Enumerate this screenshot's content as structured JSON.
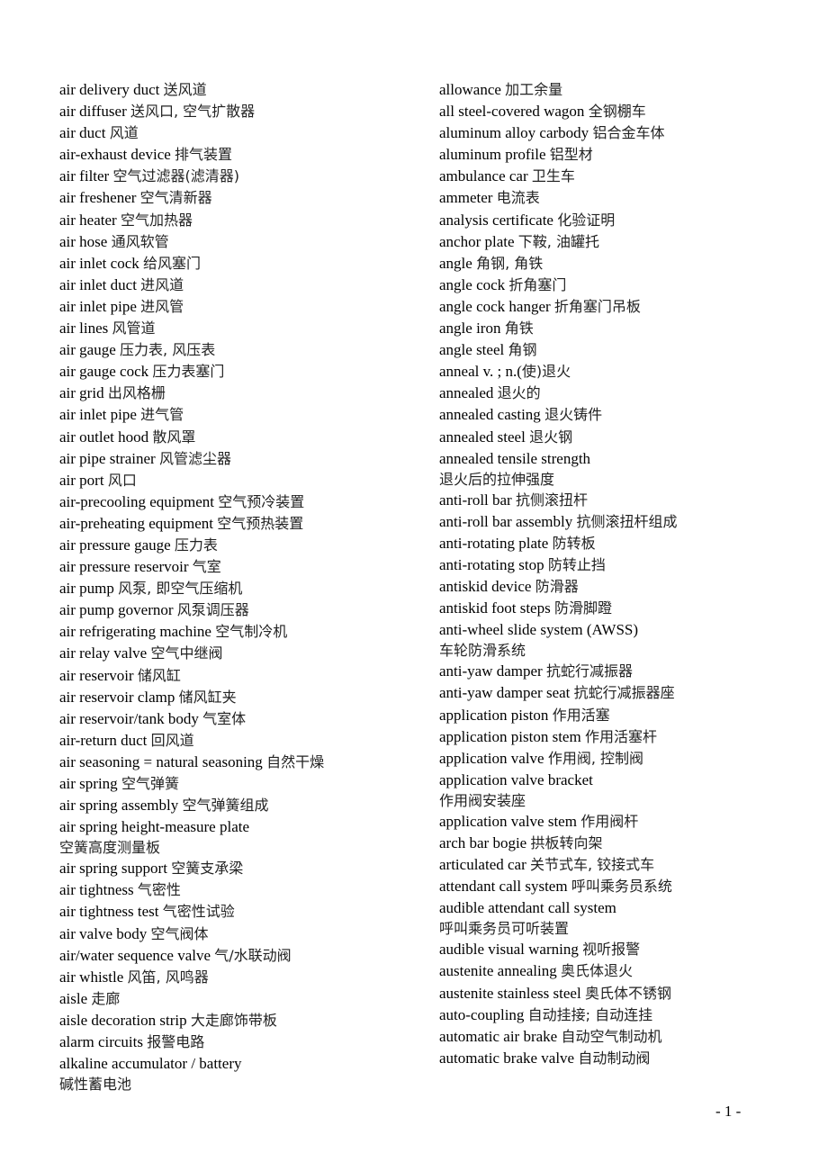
{
  "left_column": [
    {
      "en": "air delivery duct ",
      "cn": "送风道"
    },
    {
      "en": "air diffuser ",
      "cn": "送风口, 空气扩散器"
    },
    {
      "en": "air duct ",
      "cn": "风道"
    },
    {
      "en": "air-exhaust device ",
      "cn": "排气装置"
    },
    {
      "en": "air filter ",
      "cn": "空气过滤器(滤清器)"
    },
    {
      "en": "air freshener ",
      "cn": "空气清新器"
    },
    {
      "en": "air heater ",
      "cn": "空气加热器"
    },
    {
      "en": "air hose ",
      "cn": "通风软管"
    },
    {
      "en": "air inlet cock ",
      "cn": "给风塞门"
    },
    {
      "en": "air inlet duct ",
      "cn": "进风道"
    },
    {
      "en": "air inlet pipe ",
      "cn": "进风管"
    },
    {
      "en": "air lines ",
      "cn": "风管道"
    },
    {
      "en": "air gauge ",
      "cn": "压力表, 风压表"
    },
    {
      "en": "air gauge cock ",
      "cn": "压力表塞门"
    },
    {
      "en": "air grid ",
      "cn": "出风格栅"
    },
    {
      "en": "air inlet pipe ",
      "cn": "进气管"
    },
    {
      "en": "air outlet hood ",
      "cn": "散风罩"
    },
    {
      "en": "air pipe strainer ",
      "cn": "风管滤尘器"
    },
    {
      "en": "air port ",
      "cn": "风口"
    },
    {
      "en": "air-precooling equipment ",
      "cn": "空气预冷装置"
    },
    {
      "en": "air-preheating equipment ",
      "cn": "空气预热装置"
    },
    {
      "en": "air pressure gauge ",
      "cn": "压力表"
    },
    {
      "en": "air pressure reservoir ",
      "cn": "气室"
    },
    {
      "en": "air pump  ",
      "cn": "风泵, 即空气压缩机"
    },
    {
      "en": "air pump governor ",
      "cn": "风泵调压器"
    },
    {
      "en": "air refrigerating machine ",
      "cn": "空气制冷机"
    },
    {
      "en": "air relay valve ",
      "cn": "空气中继阀"
    },
    {
      "en": "air reservoir ",
      "cn": "储风缸"
    },
    {
      "en": "air reservoir clamp ",
      "cn": "储风缸夹"
    },
    {
      "en": "air reservoir/tank body ",
      "cn": "气室体"
    },
    {
      "en": "air-return duct ",
      "cn": "回风道"
    },
    {
      "en": "air seasoning = natural seasoning ",
      "cn": "自然干燥"
    },
    {
      "en": "air spring ",
      "cn": "空气弹簧"
    },
    {
      "en": "air spring assembly ",
      "cn": "空气弹簧组成"
    },
    {
      "en": "air spring height-measure plate",
      "cn": "空簧高度测量板",
      "wrap": true
    },
    {
      "en": "air spring support ",
      "cn": "空簧支承梁"
    },
    {
      "en": "air tightness ",
      "cn": "气密性"
    },
    {
      "en": "air tightness test ",
      "cn": "气密性试验"
    },
    {
      "en": "air valve body ",
      "cn": "空气阀体"
    },
    {
      "en": "air/water sequence valve ",
      "cn": "气/水联动阀"
    },
    {
      "en": "air whistle ",
      "cn": "风笛, 风鸣器"
    },
    {
      "en": "aisle  ",
      "cn": "走廊"
    },
    {
      "en": "aisle decoration strip  ",
      "cn": "大走廊饰带板"
    },
    {
      "en": "alarm circuits  ",
      "cn": "报警电路"
    },
    {
      "en": "alkaline accumulator / battery",
      "cn": "碱性蓄电池",
      "wrap": true
    }
  ],
  "right_column": [
    {
      "en": "allowance ",
      "cn": "加工余量"
    },
    {
      "en": "all steel-covered wagon ",
      "cn": "全钢棚车"
    },
    {
      "en": "aluminum alloy carbody ",
      "cn": "铝合金车体"
    },
    {
      "en": "aluminum profile ",
      "cn": "铝型材"
    },
    {
      "en": "ambulance car ",
      "cn": "卫生车"
    },
    {
      "en": "ammeter ",
      "cn": "电流表"
    },
    {
      "en": "analysis certificate ",
      "cn": "化验证明"
    },
    {
      "en": "anchor plate ",
      "cn": "下鞍, 油罐托"
    },
    {
      "en": "angle ",
      "cn": "角钢, 角铁"
    },
    {
      "en": "angle cock ",
      "cn": "折角塞门"
    },
    {
      "en": "angle cock hanger ",
      "cn": "折角塞门吊板"
    },
    {
      "en": "angle iron ",
      "cn": "角铁"
    },
    {
      "en": "angle steel ",
      "cn": "角钢"
    },
    {
      "en": "anneal v. ; n.(",
      "cn": "使)退火",
      "mixed": true
    },
    {
      "en": "annealed ",
      "cn": "退火的"
    },
    {
      "en": "annealed casting ",
      "cn": "退火铸件"
    },
    {
      "en": "annealed steel ",
      "cn": "退火钢"
    },
    {
      "en": "annealed tensile strength",
      "cn": "退火后的拉伸强度",
      "wrap": true
    },
    {
      "en": " anti-roll bar ",
      "cn": "抗侧滚扭杆"
    },
    {
      "en": "anti-roll bar assembly ",
      "cn": "抗侧滚扭杆组成"
    },
    {
      "en": "anti-rotating plate ",
      "cn": "防转板"
    },
    {
      "en": "anti-rotating stop  ",
      "cn": "防转止挡"
    },
    {
      "en": "antiskid device ",
      "cn": "防滑器"
    },
    {
      "en": "antiskid foot steps ",
      "cn": "防滑脚蹬"
    },
    {
      "en": "anti-wheel slide system (AWSS)",
      "cn": " 车轮防滑系统",
      "wrap": true
    },
    {
      "en": "anti-yaw damper ",
      "cn": "抗蛇行减振器"
    },
    {
      "en": "anti-yaw damper seat ",
      "cn": "抗蛇行减振器座"
    },
    {
      "en": "application piston ",
      "cn": "作用活塞"
    },
    {
      "en": "application piston stem ",
      "cn": "作用活塞杆"
    },
    {
      "en": "application valve ",
      "cn": "作用阀, 控制阀"
    },
    {
      "en": "application valve bracket",
      "cn": "作用阀安装座",
      "wrap": true
    },
    {
      "en": "application valve stem ",
      "cn": "作用阀杆"
    },
    {
      "en": "arch bar bogie ",
      "cn": "拱板转向架"
    },
    {
      "en": "articulated car ",
      "cn": "关节式车, 铰接式车"
    },
    {
      "en": "attendant call system ",
      "cn": "呼叫乘务员系统"
    },
    {
      "en": "audible attendant call system",
      "cn": "呼叫乘务员可听装置",
      "wrap": true
    },
    {
      "en": "audible visual warning ",
      "cn": "视听报警"
    },
    {
      "en": "austenite annealing ",
      "cn": "奥氏体退火"
    },
    {
      "en": "austenite stainless steel ",
      "cn": "奥氏体不锈钢"
    },
    {
      "en": "auto-coupling ",
      "cn": "自动挂接; 自动连挂"
    },
    {
      "en": "automatic air brake ",
      "cn": "自动空气制动机"
    },
    {
      "en": "automatic  brake valve ",
      "cn": "自动制动阀"
    }
  ],
  "footer": {
    "page_number": "- 1 -"
  }
}
